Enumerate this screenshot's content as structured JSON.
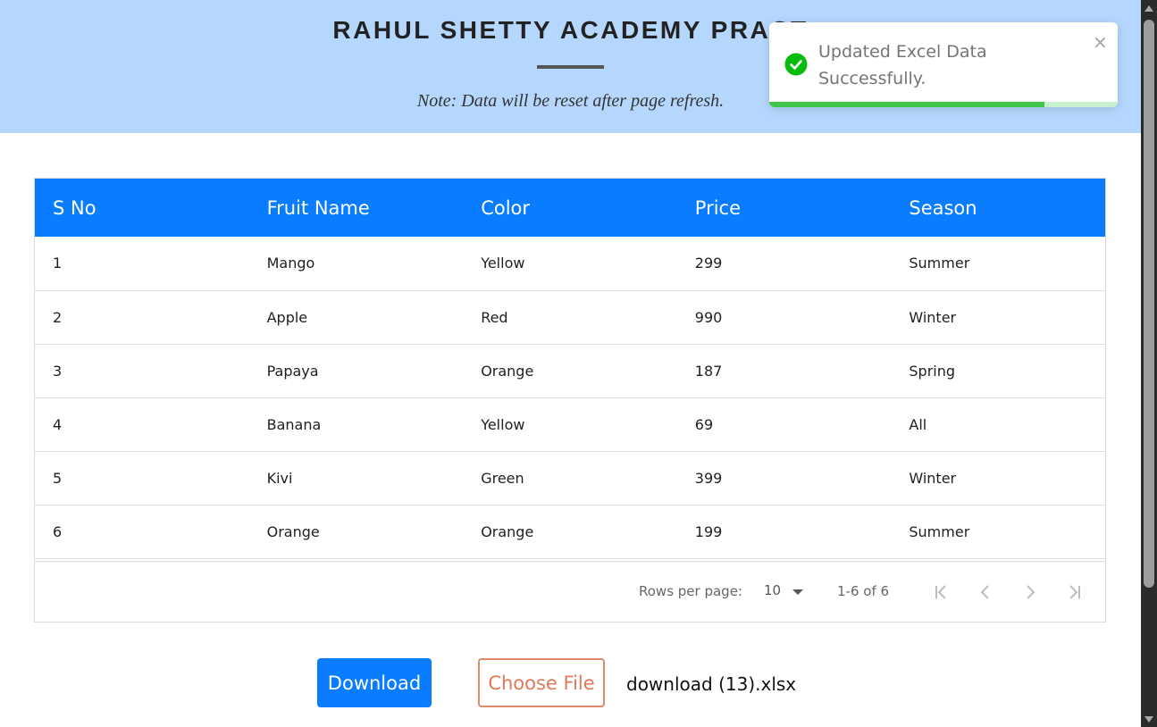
{
  "header": {
    "title": "RAHUL SHETTY ACADEMY PRACT",
    "note": "Note: Data will be reset after page refresh."
  },
  "table": {
    "columns": [
      "S No",
      "Fruit Name",
      "Color",
      "Price",
      "Season"
    ],
    "rows": [
      [
        "1",
        "Mango",
        "Yellow",
        "299",
        "Summer"
      ],
      [
        "2",
        "Apple",
        "Red",
        "990",
        "Winter"
      ],
      [
        "3",
        "Papaya",
        "Orange",
        "187",
        "Spring"
      ],
      [
        "4",
        "Banana",
        "Yellow",
        "69",
        "All"
      ],
      [
        "5",
        "Kivi",
        "Green",
        "399",
        "Winter"
      ],
      [
        "6",
        "Orange",
        "Orange",
        "199",
        "Summer"
      ]
    ]
  },
  "pagination": {
    "rows_per_page_label": "Rows per page:",
    "rows_per_page_value": "10",
    "range_text": "1-6 of 6",
    "icons": [
      "first-page-icon",
      "previous-page-icon",
      "next-page-icon",
      "last-page-icon"
    ]
  },
  "actions": {
    "download_label": "Download",
    "choose_file_label": "Choose File",
    "file_name": "download (13).xlsx"
  },
  "toast": {
    "message": "Updated Excel Data Successfully.",
    "close_glyph": "×",
    "progress": 0.79,
    "icon": "check-circle-icon"
  },
  "colors": {
    "header_bg": "#b5d7fd",
    "table_header_bg": "#0a7cff",
    "download_bg": "#0a7cff",
    "choose_file_border": "#e08a6b",
    "toast_success": "#3ec54a"
  }
}
